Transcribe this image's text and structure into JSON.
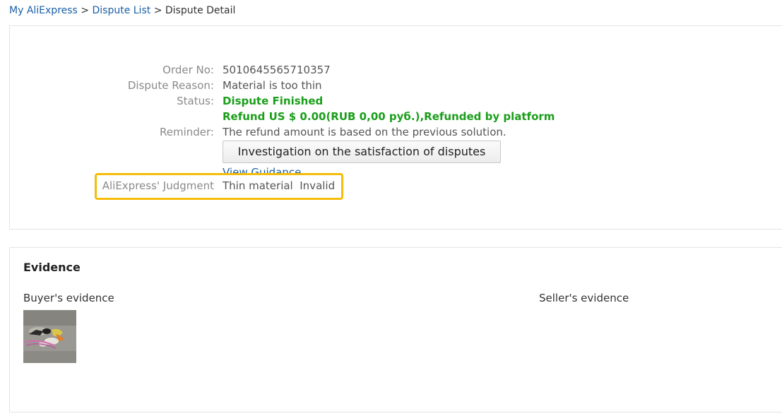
{
  "breadcrumb": {
    "home": "My AliExpress",
    "list": "Dispute List",
    "current": "Dispute Detail",
    "separator": ">"
  },
  "detail": {
    "order_no_label": "Order No:",
    "order_no_value": "5010645565710357",
    "reason_label": "Dispute Reason:",
    "reason_value": "Material is too thin",
    "status_label": "Status:",
    "status_value": "Dispute Finished",
    "refund_value": "Refund US $ 0.00(RUB 0,00 руб.),Refunded by platform",
    "reminder_label": "Reminder:",
    "reminder_value": "The refund amount is based on the previous solution.",
    "survey_button": "Investigation on the satisfaction of disputes",
    "guidance_link": "View Guidance",
    "judgment_label": "AliExpress' Judgment",
    "judgment_value": "Thin material  Invalid"
  },
  "evidence": {
    "title": "Evidence",
    "buyer_label": "Buyer's evidence",
    "seller_label": "Seller's evidence",
    "buyer_images": [
      "buyer-evidence-photo"
    ]
  },
  "colors": {
    "link": "#1a5fa6",
    "status_green": "#1a9e1a",
    "highlight": "#f5bd0a",
    "label_gray": "#8a8a8a"
  }
}
